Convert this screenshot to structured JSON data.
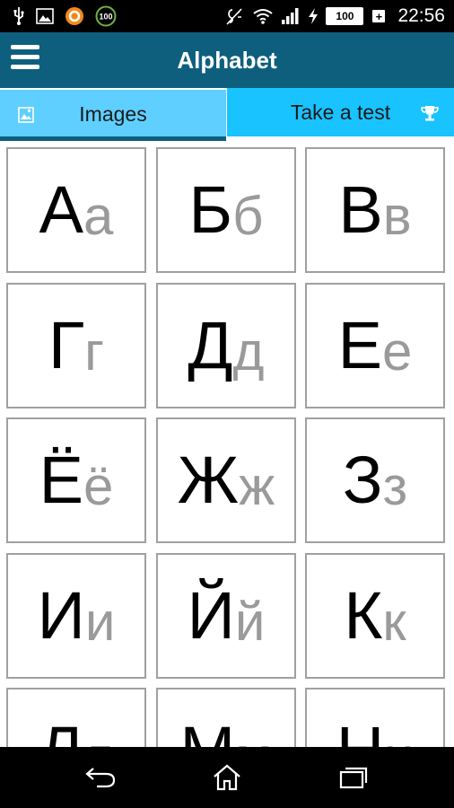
{
  "status_bar": {
    "time": "22:56",
    "battery": "100",
    "battery_plus": "+",
    "notif_badge": "100"
  },
  "app_bar": {
    "title": "Alphabet"
  },
  "tabs": [
    {
      "label": "Images"
    },
    {
      "label": "Take a test"
    }
  ],
  "letters": [
    {
      "upper": "А",
      "lower": "а"
    },
    {
      "upper": "Б",
      "lower": "б"
    },
    {
      "upper": "В",
      "lower": "в"
    },
    {
      "upper": "Г",
      "lower": "г"
    },
    {
      "upper": "Д",
      "lower": "д"
    },
    {
      "upper": "Е",
      "lower": "е"
    },
    {
      "upper": "Ё",
      "lower": "ё"
    },
    {
      "upper": "Ж",
      "lower": "ж"
    },
    {
      "upper": "З",
      "lower": "з"
    },
    {
      "upper": "И",
      "lower": "и"
    },
    {
      "upper": "Й",
      "lower": "й"
    },
    {
      "upper": "К",
      "lower": "к"
    },
    {
      "upper": "Л",
      "lower": "л"
    },
    {
      "upper": "М",
      "lower": "м"
    },
    {
      "upper": "Н",
      "lower": "н"
    }
  ],
  "colors": {
    "app_bar": "#0e5f7e",
    "tab_active": "#5ecfff",
    "tab_inactive": "#18c3ff",
    "lower_letter": "#9a9a9a"
  }
}
